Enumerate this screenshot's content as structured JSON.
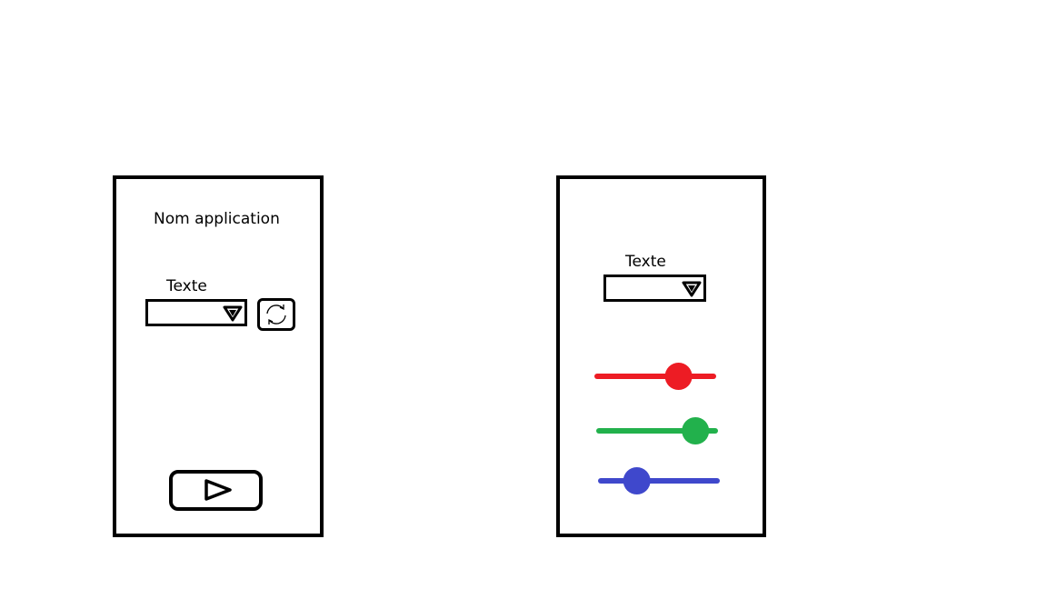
{
  "screen_left": {
    "app_name": "Nom application",
    "field_label": "Texte",
    "dropdown_selected": "",
    "refresh_icon": "refresh-icon",
    "play_icon": "play-icon"
  },
  "screen_right": {
    "field_label": "Texte",
    "dropdown_selected": "",
    "sliders": [
      {
        "name": "red-slider",
        "color": "#ed1c24",
        "value": 0.7
      },
      {
        "name": "green-slider",
        "color": "#22b14c",
        "value": 0.83
      },
      {
        "name": "blue-slider",
        "color": "#3f48cc",
        "value": 0.31
      }
    ]
  }
}
